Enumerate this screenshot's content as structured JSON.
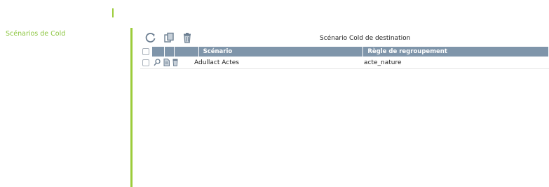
{
  "sidebar": {
    "title": "Scénarios de Cold"
  },
  "toolbar": {
    "buttons": [
      {
        "name": "refresh-icon"
      },
      {
        "name": "copy-icon"
      },
      {
        "name": "trash-icon"
      }
    ]
  },
  "table": {
    "title": "Scénario Cold de destination",
    "columns": [
      "Scénario",
      "Règle de regroupement"
    ],
    "rows": [
      {
        "scenario": "Adullact Actes",
        "rule": "acte_nature"
      }
    ]
  },
  "colors": {
    "accent_green": "#8cc63f",
    "header_bg": "#7f95aa"
  }
}
